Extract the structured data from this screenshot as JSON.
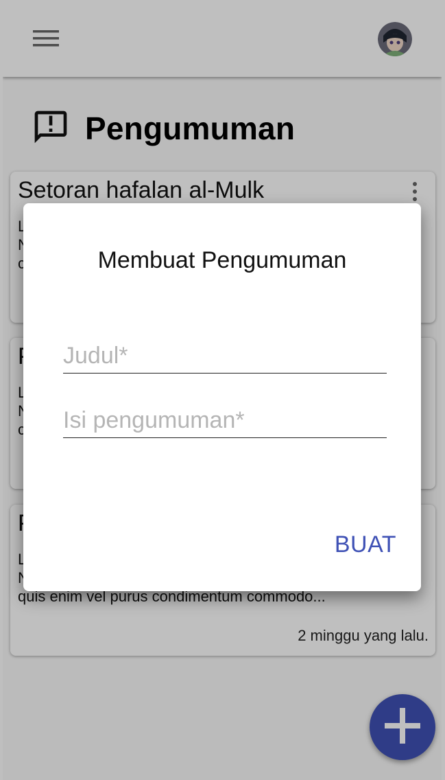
{
  "appbar": {
    "menu_icon": "hamburger-menu-icon",
    "avatar": "user-avatar"
  },
  "page": {
    "title": "Pengumuman",
    "icon": "announcement-icon"
  },
  "cards": [
    {
      "title": "Setoran hafalan al-Mulk",
      "body_lines": [
        "L",
        "N",
        "c"
      ],
      "time": ""
    },
    {
      "title": "P",
      "body_lines": [
        "L",
        "N",
        "c"
      ],
      "time": ""
    },
    {
      "title": "P",
      "body_lines": [
        "L",
        "N",
        "quis enim vel purus condimentum commodo..."
      ],
      "time": "2 minggu yang lalu."
    }
  ],
  "dialog": {
    "title": "Membuat Pengumuman",
    "title_field": {
      "placeholder": "Judul*",
      "value": ""
    },
    "content_field": {
      "placeholder": "Isi pengumuman*",
      "value": ""
    },
    "submit_label": "BUAT"
  },
  "fab": {
    "icon": "plus-icon"
  },
  "colors": {
    "accent": "#3f51b5",
    "scrim": "rgba(0,0,0,0.25)"
  }
}
